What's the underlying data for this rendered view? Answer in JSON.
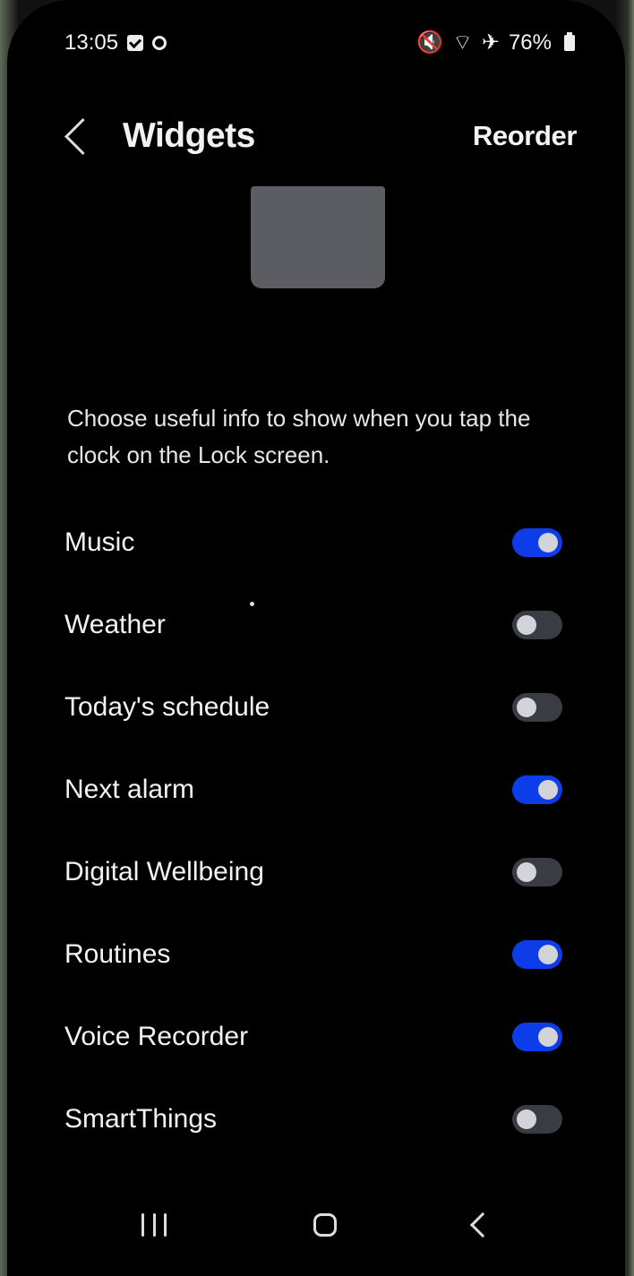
{
  "status_bar": {
    "time": "13:05",
    "battery": "76%",
    "icons": [
      "checkbox-icon",
      "face-icon",
      "mute-icon",
      "wifi-icon",
      "airplane-icon",
      "battery-icon"
    ]
  },
  "header": {
    "title": "Widgets",
    "reorder_label": "Reorder",
    "back_icon": "chevron-left-icon"
  },
  "description": "Choose useful info to show when you tap the clock on the Lock screen.",
  "settings": {
    "items": [
      {
        "label": "Music",
        "enabled": true
      },
      {
        "label": "Weather",
        "enabled": false
      },
      {
        "label": "Today's schedule",
        "enabled": false
      },
      {
        "label": "Next alarm",
        "enabled": true
      },
      {
        "label": "Digital Wellbeing",
        "enabled": false
      },
      {
        "label": "Routines",
        "enabled": true
      },
      {
        "label": "Voice Recorder",
        "enabled": true
      },
      {
        "label": "SmartThings",
        "enabled": false
      }
    ]
  },
  "navigation": {
    "icons": [
      "recents-icon",
      "home-icon",
      "back-icon"
    ]
  },
  "colors": {
    "toggle_on": "#0d3de8",
    "toggle_off": "#3a3c43",
    "knob": "#d3d3da",
    "background": "#000000"
  }
}
